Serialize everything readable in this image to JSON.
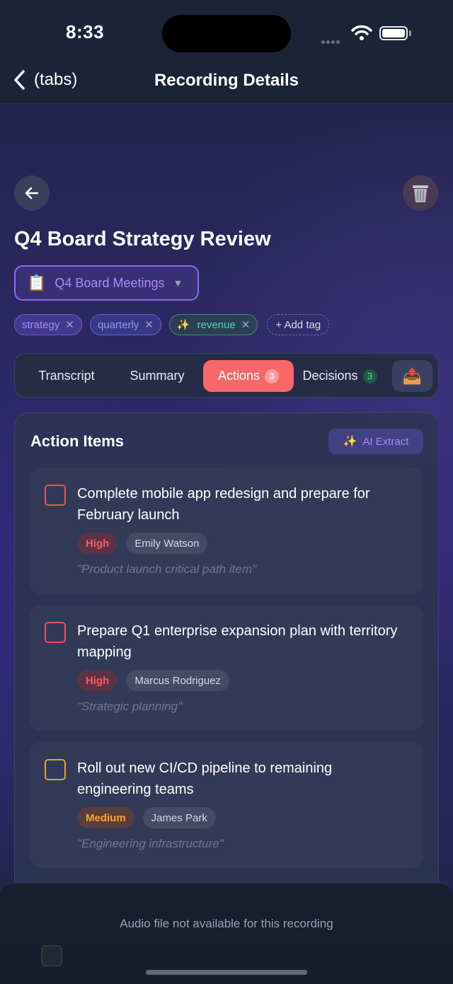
{
  "status": {
    "time": "8:33"
  },
  "nav": {
    "back_label": "(tabs)",
    "title": "Recording Details"
  },
  "recording": {
    "title": "Q4 Board Strategy Review",
    "folder": {
      "icon": "📋",
      "label": "Q4 Board Meetings",
      "caret": "▼"
    },
    "tags": [
      {
        "label": "strategy",
        "icon": ""
      },
      {
        "label": "quarterly",
        "icon": ""
      },
      {
        "label": "revenue",
        "icon": "✨"
      }
    ],
    "add_tag_label": "+ Add tag"
  },
  "tabs": {
    "transcript": "Transcript",
    "summary": "Summary",
    "actions": "Actions",
    "actions_count": "3",
    "decisions": "Decisions",
    "decisions_count": "3",
    "export_icon": "📤",
    "active": "actions"
  },
  "actions_panel": {
    "title": "Action Items",
    "ai_extract_label": "AI Extract",
    "ai_extract_icon": "✨",
    "items": [
      {
        "text": "Complete mobile app redesign and prepare for February launch",
        "priority": "High",
        "assignee": "Emily Watson",
        "note": "\"Product launch critical path item\""
      },
      {
        "text": "Prepare Q1 enterprise expansion plan with territory mapping",
        "priority": "High",
        "assignee": "Marcus Rodriguez",
        "note": "\"Strategic planning\""
      },
      {
        "text": "Roll out new CI/CD pipeline to remaining engineering teams",
        "priority": "Medium",
        "assignee": "James Park",
        "note": "\"Engineering infrastructure\""
      }
    ]
  },
  "audio": {
    "message": "Audio file not available for this recording"
  },
  "colors": {
    "accent": "#f8686b",
    "folder": "#8b6cf0",
    "high": "#ff5a5a",
    "medium": "#ffa533"
  }
}
